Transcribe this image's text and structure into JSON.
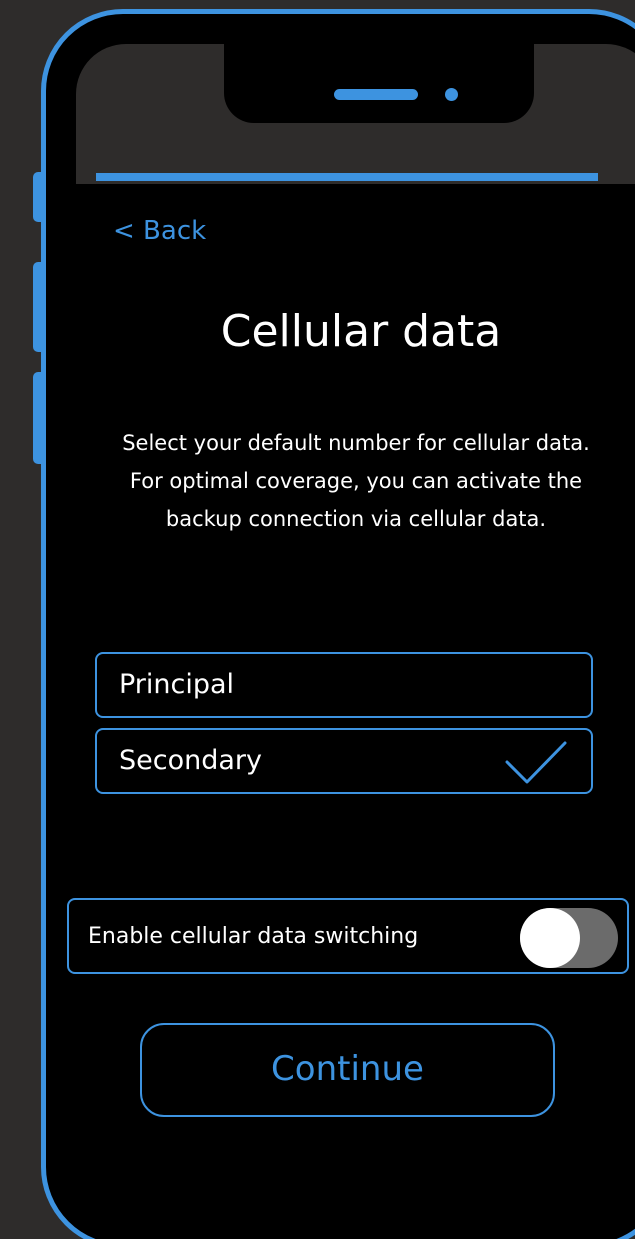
{
  "colors": {
    "accent": "#3d93e0",
    "background": "#2e2c2b",
    "screen": "#000000",
    "text": "#ffffff",
    "toggle_track": "#6b6b6b"
  },
  "nav": {
    "back_label": "< Back"
  },
  "page": {
    "title": "Cellular data",
    "description": "Select your default number for cellular data. For optimal coverage, you can activate the backup connection via cellular data."
  },
  "options": [
    {
      "label": "Principal",
      "selected": false
    },
    {
      "label": "Secondary",
      "selected": true,
      "icon": "check-icon"
    }
  ],
  "switching": {
    "label": "Enable cellular data switching",
    "enabled": false
  },
  "actions": {
    "continue_label": "Continue"
  }
}
